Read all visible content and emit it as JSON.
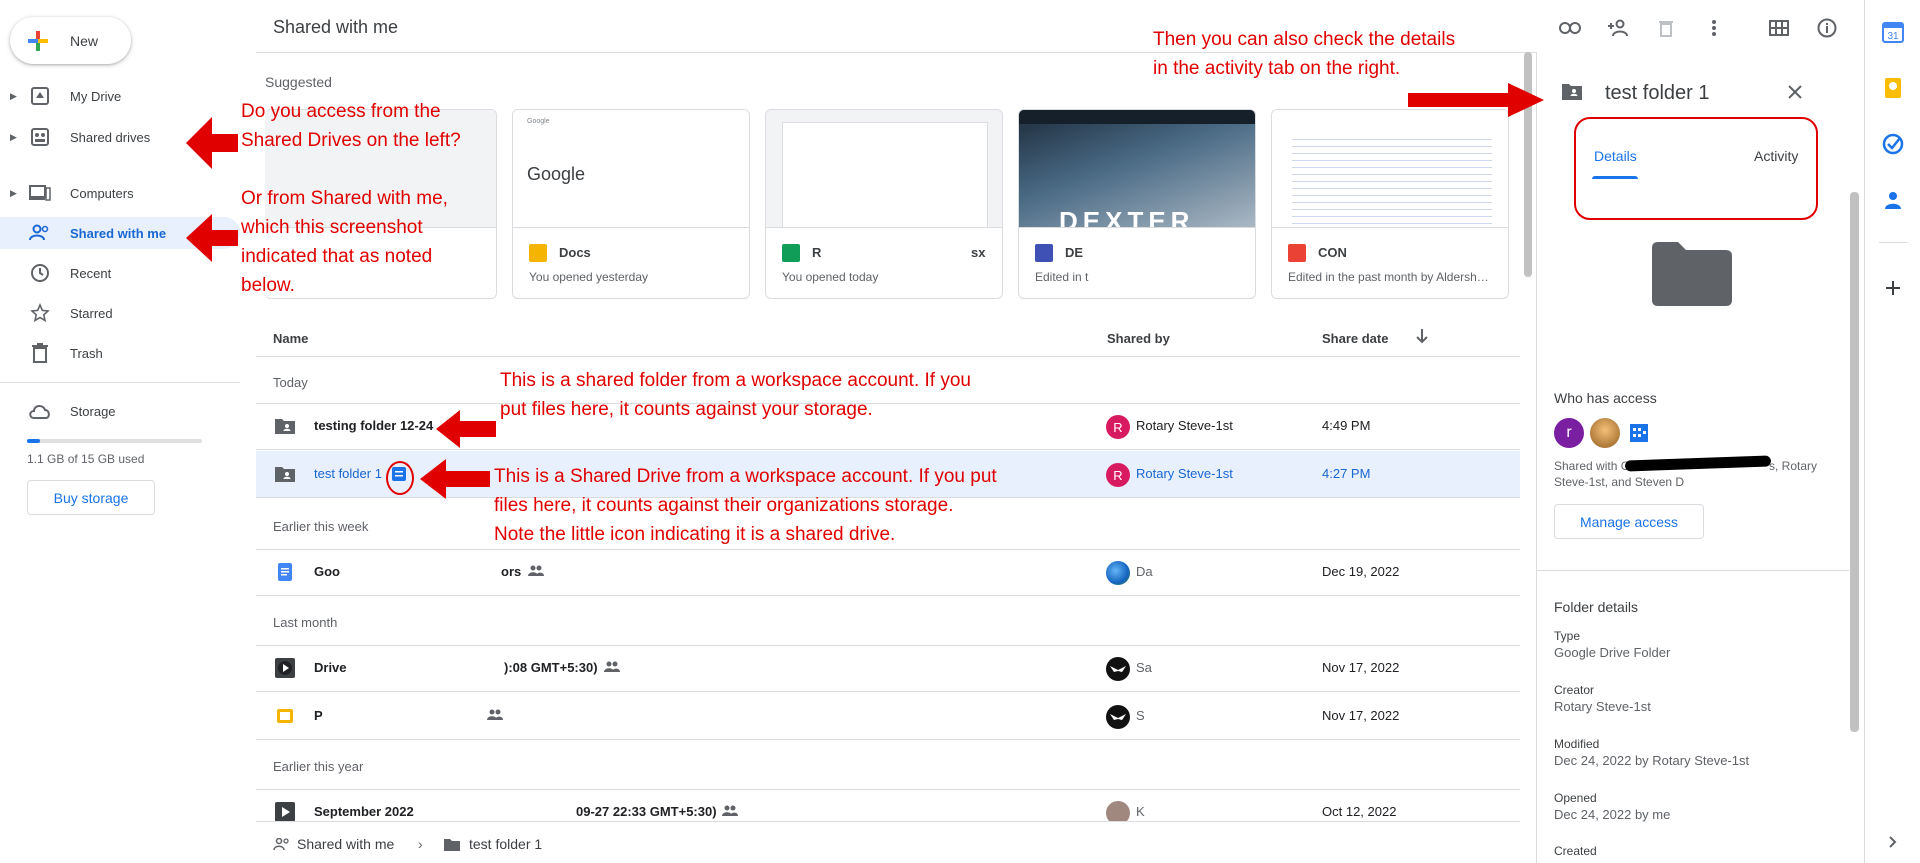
{
  "sidebar": {
    "new_label": "New",
    "items": [
      {
        "label": "My Drive",
        "icon": "my-drive-icon"
      },
      {
        "label": "Shared drives",
        "icon": "shared-drives-icon"
      },
      {
        "label": "Computers",
        "icon": "computers-icon"
      },
      {
        "label": "Shared with me",
        "icon": "shared-with-me-icon"
      },
      {
        "label": "Recent",
        "icon": "clock-icon"
      },
      {
        "label": "Starred",
        "icon": "star-icon"
      },
      {
        "label": "Trash",
        "icon": "trash-icon"
      }
    ],
    "storage_label": "Storage",
    "storage_used": "1.1 GB of 15 GB used",
    "storage_fraction": 0.073,
    "buy_storage": "Buy storage"
  },
  "header": {
    "title": "Shared with me",
    "icons": [
      "link-icon",
      "add-person-icon",
      "trash-icon",
      "more-icon",
      "grid-view-icon",
      "info-icon"
    ]
  },
  "suggested": {
    "label": "Suggested",
    "cards": [
      {
        "title": "Docs",
        "subtitle": "You opened yesterday",
        "thumb_text": "Google",
        "color": "#f4b400"
      },
      {
        "title": "R",
        "title2": "sx",
        "subtitle": "You opened today",
        "color": "#0f9d58"
      },
      {
        "title": "DE",
        "subtitle": "Edited in t",
        "thumb_text": "DEXTER",
        "color": "#3f51b5"
      },
      {
        "title": "CON",
        "subtitle": "Edited in the past month by Aldersh…",
        "color": "#ea4335"
      }
    ]
  },
  "list": {
    "columns": {
      "name": "Name",
      "shared_by": "Shared by",
      "share_date": "Share date"
    },
    "groups": [
      {
        "label": "Today"
      },
      {
        "label": "Earlier this week"
      },
      {
        "label": "Last month"
      },
      {
        "label": "Earlier this year"
      }
    ],
    "rows": [
      {
        "name": "testing folder 12-24",
        "shared_by": "Rotary Steve-1st",
        "avatar": "R",
        "date": "4:49 PM"
      },
      {
        "name": "test folder 1",
        "shared_by": "Rotary Steve-1st",
        "avatar": "R",
        "date": "4:27 PM"
      },
      {
        "name": "Goo",
        "frag": "ors",
        "shared_by": "Da",
        "date": "Dec 19, 2022"
      },
      {
        "name": "Drive",
        "frag": "):08 GMT+5:30)",
        "shared_by": "Sa",
        "date": "Nov 17, 2022"
      },
      {
        "name": "P",
        "shared_by": "S",
        "date": "Nov 17, 2022"
      },
      {
        "name": "September 2022",
        "frag": "09-27 22:33 GMT+5:30)",
        "shared_by": "K",
        "date": "Oct 12, 2022"
      }
    ]
  },
  "breadcrumb": {
    "root": "Shared with me",
    "current": "test folder 1"
  },
  "panel": {
    "title": "test folder 1",
    "tabs": {
      "details": "Details",
      "activity": "Activity"
    },
    "who_has_access": "Who has access",
    "access_avatar": "r",
    "shared_with": "Shared with Go",
    "shared_with_2": "s, Rotary",
    "shared_with_3": "Steve-1st, and Steven D",
    "manage_access": "Manage access",
    "folder_details": "Folder details",
    "fields": [
      {
        "label": "Type",
        "value": "Google Drive Folder"
      },
      {
        "label": "Creator",
        "value": "Rotary Steve-1st"
      },
      {
        "label": "Modified",
        "value": "Dec 24, 2022 by Rotary Steve-1st"
      },
      {
        "label": "Opened",
        "value": "Dec 24, 2022 by me"
      },
      {
        "label": "Created",
        "value": ""
      }
    ]
  },
  "annotations": {
    "n1": [
      "Then you can also check the details",
      "in the activity tab on the right."
    ],
    "n2": [
      "Do you access from the",
      "Shared Drives on the left?"
    ],
    "n3": [
      "Or from Shared with me,",
      "which this screenshot",
      "indicated that as noted",
      "below."
    ],
    "n4": [
      "This is a shared folder from a workspace account.  If you",
      "put files here, it counts against your storage."
    ],
    "n5": [
      "This is a Shared Drive from a workspace account.  If you put",
      "files here, it counts against their organizations storage.",
      "Note the little icon indicating it is a shared drive."
    ]
  },
  "colors": {
    "accent": "#1a73e8",
    "annotation": "#e00000",
    "selected": "#e8f0fe"
  }
}
